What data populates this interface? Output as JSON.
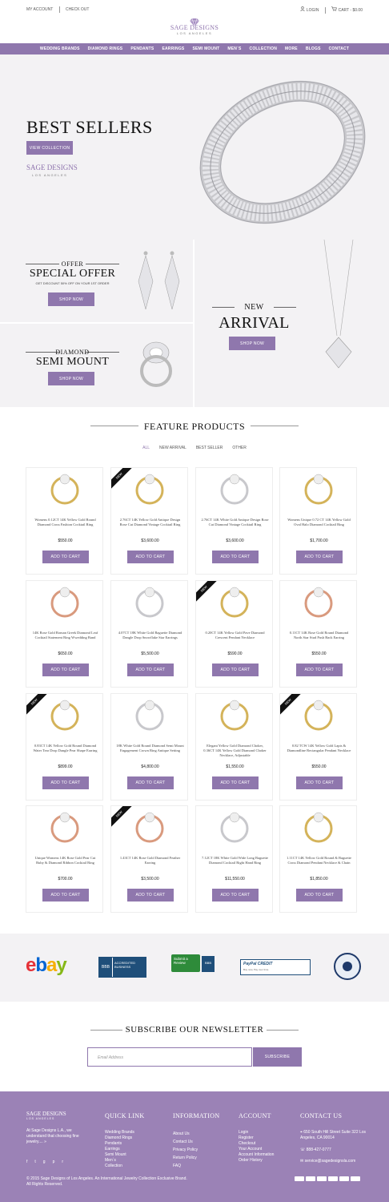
{
  "topbar": {
    "my_account": "MY ACCOUNT",
    "checkout": "CHECK OUT",
    "login": "LOGIN",
    "cart": "CART - $0.00"
  },
  "logo": {
    "name": "SAGE DESIGNS",
    "sub": "LOS ANGELES"
  },
  "nav": [
    "WEDDING BRANDS",
    "DIAMOND RINGS",
    "PENDANTS",
    "EARRINGS",
    "SEMI MOUNT",
    "MEN`S",
    "COLLECTION",
    "MORE",
    "BLOGS",
    "CONTACT"
  ],
  "hero": {
    "title": "BEST SELLERS",
    "button": "VIEW COLLECTION",
    "brand": "SAGE DESIGNS",
    "brand_sub": "LOS ANGELES"
  },
  "promos": {
    "offer": {
      "small": "OFFER",
      "big": "SPECIAL OFFER",
      "desc": "GET DISCOUNT 50% OFF ON YOUR 1ST ORDER",
      "button": "SHOP NOW"
    },
    "semi": {
      "small": "DIAMOND",
      "big": "SEMI MOUNT",
      "button": "SHOP NOW"
    },
    "arrival": {
      "small": "NEW",
      "big": "ARRIVAL",
      "button": "SHOP NOW"
    }
  },
  "featured": {
    "title": "FEATURE PRODUCTS",
    "filters": [
      "ALL",
      "NEW ARRIVAL",
      "BEST SELLER",
      "OTHER"
    ],
    "add_label": "ADD TO CART",
    "new_label": "NEW",
    "products": [
      {
        "name": "Womens 0.12CT 14K Yellow Gold Round Diamond Cross Fashion Cocktail Ring",
        "price": "$550.00",
        "new": false
      },
      {
        "name": "2.76CT 14K Yellow Gold Antique Design Rose Cut Diamond Vintage Cocktail Ring",
        "price": "$3,600.00",
        "new": true
      },
      {
        "name": "2.76CT 14K White Gold Antique Design Rose Cut Diamond Vintage Cocktail Ring",
        "price": "$3,600.00",
        "new": false
      },
      {
        "name": "Womens Unique 0.72 CT 14K Yellow Gold Oval Halo Diamond Cocktail Ring",
        "price": "$1,700.00",
        "new": false
      },
      {
        "name": "14K Rose Gold Roman Greek Diamond Leaf Cocktail Statement Ring Wwedding Band",
        "price": "$650.00",
        "new": false
      },
      {
        "name": "4.07CT 18K White Gold Baguette Diamond Dangle Drop Snowflake Star Earrings",
        "price": "$5,500.00",
        "new": false
      },
      {
        "name": "0.20CT 14K Yellow Gold Pave Diamond Crescent Pendant Necklace",
        "price": "$590.00",
        "new": true
      },
      {
        "name": "0.11CT 14K Rose Gold Round Diamond North Star Stud Push Back Earring",
        "price": "$550.00",
        "new": false
      },
      {
        "name": "0.83CT 14K Yellow Gold Round Diamond Water Tear Drop Dangle Pear Shape Earring",
        "price": "$899.00",
        "new": true
      },
      {
        "name": "18K White Gold Round Diamond Semi Mount Engagement Crown Ring Antique Setting",
        "price": "$4,800.00",
        "new": false
      },
      {
        "name": "Elegant Yellow Gold Diamond Choker, 0.36CT 14K Yellow Gold Diamond Choker Necklace, Adjustable",
        "price": "$1,550.00",
        "new": false
      },
      {
        "name": "0.82 TCW 14K Yellow Gold Lapis & Diamondline Rectangular Pendant Necklace",
        "price": "$550.00",
        "new": true
      },
      {
        "name": "Unique Womens 14K Rose Gold Pear Cut Ruby & Diamond Ribbon Cocktail Ring",
        "price": "$700.00",
        "new": false
      },
      {
        "name": "1.43CT 14K Rose Gold Diamond Feather Earring",
        "price": "$3,500.00",
        "new": true
      },
      {
        "name": "7.12CT 18K White Gold Wide Long Baguette Diamond Cocktail Right Hand Ring",
        "price": "$11,550.00",
        "new": false
      },
      {
        "name": "1.11CT 14K Yellow Gold Round & Baguette Cross Diamond Pendant Necklace & Chain",
        "price": "$1,850.00",
        "new": false
      }
    ]
  },
  "partners": {
    "ebay": "ebay",
    "bbb1": "ACCREDITED BUSINESS",
    "bbb2": "Submit a Review",
    "paypal": "PayPal CREDIT"
  },
  "newsletter": {
    "title": "SUBSCRIBE OUR NEWSLETTER",
    "placeholder": "Email Address",
    "button": "SUBSCRIBE"
  },
  "footer": {
    "logo_name": "SAGE DESIGNS",
    "logo_sub": "LOS ANGELES",
    "about": "At Sage Designs L.A., we understand that choosing fine jewelry.... »",
    "quick_title": "QUICK LINK",
    "quick": [
      "Wedding Brands",
      "Diamond Rings",
      "Pendants",
      "Earrings",
      "Semi Mount",
      "Men`s",
      "Collection"
    ],
    "info_title": "INFORMATION",
    "info": [
      "About Us",
      "Contact Us",
      "Privacy Policy",
      "Return Policy",
      "FAQ"
    ],
    "account_title": "ACCOUNT",
    "account": [
      "Login",
      "Register",
      "Checkout",
      "Your Account",
      "Account Information",
      "Order History"
    ],
    "contact_title": "CONTACT US",
    "address": "650 South Hill Street Suite 322 Los Angeles, CA 90014",
    "phone": "888-427-0777",
    "email": "service@sagedesignsla.com",
    "copyright": "© 2015 Sage Designs of Los Angeles. An International Jewelry Collection Exclusive Brand.",
    "rights": "All Rights Reserved.",
    "colors": {
      "accent": "#8f77ad",
      "footer": "#9b82b6"
    }
  }
}
